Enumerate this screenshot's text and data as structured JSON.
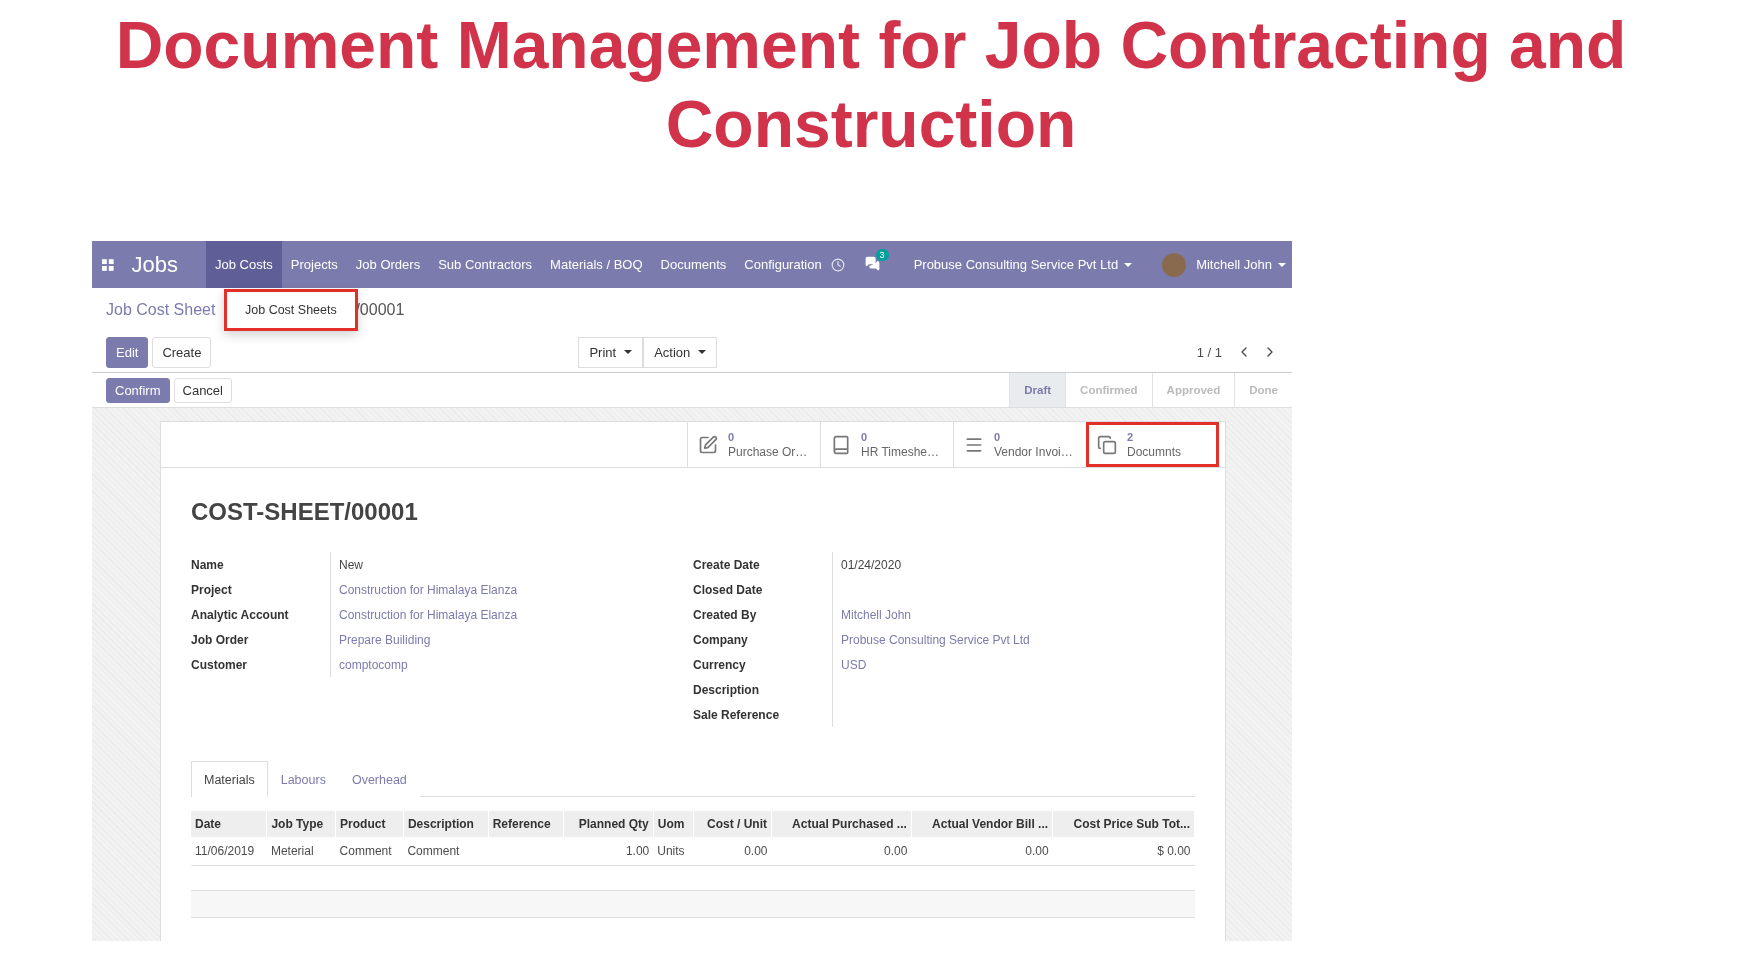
{
  "slide_title": "Document Management for Job Contracting and Construction",
  "navbar": {
    "app_title": "Jobs",
    "menu": [
      {
        "label": "Job Costs",
        "selected": true
      },
      {
        "label": "Projects",
        "selected": false
      },
      {
        "label": "Job Orders",
        "selected": false
      },
      {
        "label": "Sub Contractors",
        "selected": false
      },
      {
        "label": "Materials / BOQ",
        "selected": false
      },
      {
        "label": "Documents",
        "selected": false
      },
      {
        "label": "Configuration",
        "selected": false
      }
    ],
    "chat_count": "3",
    "company": "Probuse Consulting Service Pvt Ltd",
    "user": "Mitchell John"
  },
  "dropdown": {
    "items": [
      {
        "label": "Job Cost Sheets",
        "highlighted": true
      }
    ]
  },
  "breadcrumb": {
    "parent": "Job Cost Sheet",
    "current": "/00001"
  },
  "control_buttons": [
    {
      "label": "Edit",
      "primary": true
    },
    {
      "label": "Create",
      "primary": false
    }
  ],
  "menus": [
    "Print",
    "Action"
  ],
  "pager": "1 / 1",
  "header_buttons": [
    {
      "label": "Confirm",
      "primary": true
    },
    {
      "label": "Cancel",
      "primary": false
    }
  ],
  "stages": [
    {
      "label": "Draft",
      "selected": true
    },
    {
      "label": "Confirmed",
      "selected": false
    },
    {
      "label": "Approved",
      "selected": false
    },
    {
      "label": "Done",
      "selected": false
    }
  ],
  "smart_buttons": [
    {
      "kind": "edit",
      "count": "0",
      "label": "Purchase Or…",
      "highlighted": false
    },
    {
      "kind": "book",
      "count": "0",
      "label": "HR Timeshe…",
      "highlighted": false
    },
    {
      "kind": "list",
      "count": "0",
      "label": "Vendor Invoi…",
      "highlighted": false
    },
    {
      "kind": "copy",
      "count": "2",
      "label": "Documnts",
      "highlighted": true
    }
  ],
  "record_title": "COST-SHEET/00001",
  "fields_left": [
    {
      "label": "Name",
      "value": "New",
      "link": false
    },
    {
      "label": "Project",
      "value": "Construction for Himalaya Elanza",
      "link": true
    },
    {
      "label": "Analytic Account",
      "value": "Construction for Himalaya Elanza",
      "link": true
    },
    {
      "label": "Job Order",
      "value": "Prepare Builiding",
      "link": true
    },
    {
      "label": "Customer",
      "value": "comptocomp",
      "link": true
    }
  ],
  "fields_right": [
    {
      "label": "Create Date",
      "value": "01/24/2020",
      "link": false
    },
    {
      "label": "Closed Date"
    },
    {
      "label": "Created By",
      "value": "Mitchell John",
      "link": true
    },
    {
      "label": "Company",
      "value": "Probuse Consulting Service Pvt Ltd",
      "link": true
    },
    {
      "label": "Currency",
      "value": "USD",
      "link": true
    },
    {
      "label": "Description"
    },
    {
      "label": "Sale Reference"
    }
  ],
  "notebook_tabs": [
    {
      "label": "Materials",
      "selected": true
    },
    {
      "label": "Labours",
      "selected": false
    },
    {
      "label": "Overhead",
      "selected": false
    }
  ],
  "table": {
    "columns": [
      {
        "label": "Date",
        "numeric": false
      },
      {
        "label": "Job Type",
        "numeric": false
      },
      {
        "label": "Product",
        "numeric": false
      },
      {
        "label": "Description",
        "numeric": false
      },
      {
        "label": "Reference",
        "numeric": false
      },
      {
        "label": "Planned Qty",
        "numeric": true
      },
      {
        "label": "Uom",
        "numeric": false
      },
      {
        "label": "Cost / Unit",
        "numeric": true
      },
      {
        "label": "Actual Purchased ...",
        "numeric": true
      },
      {
        "label": "Actual Vendor Bill ...",
        "numeric": true
      },
      {
        "label": "Cost Price Sub Tot...",
        "numeric": true
      }
    ],
    "rows": [
      [
        "11/06/2019",
        "Meterial",
        "Comment",
        "Comment",
        "",
        "1.00",
        "Units",
        "0.00",
        "0.00",
        "0.00",
        "$ 0.00"
      ]
    ]
  }
}
